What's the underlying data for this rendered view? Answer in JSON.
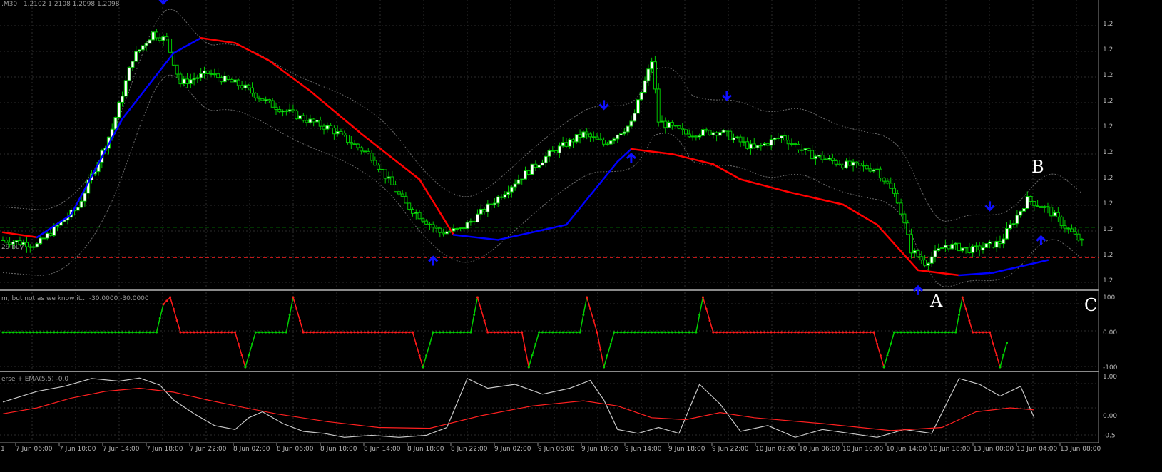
{
  "header": {
    "main_title": "",
    "main_prices": "1.2102 1.2108 1.2098 1.2098",
    "main_title_partial": ",M30",
    "osc1_title": "m, but not as we know it... -30.0000 -30.0000",
    "osc2_title": "erse + EMA(5,5) -0.0",
    "line_label": "29 buy"
  },
  "markers": {
    "a": "A",
    "b": "B",
    "c": "C"
  },
  "colors": {
    "bull_candle": "#00c800",
    "body_fill": "#ffffff",
    "ma_up": "#0000ff",
    "ma_down": "#ff0000",
    "osc_up": "#00d000",
    "osc_down": "#ff1a1a",
    "signal_arrow": "#1010ff",
    "osc2_line": "#c8c8c8",
    "osc2_ema": "#ff2020"
  },
  "x_ticks": [
    "7 Jun 06:00",
    "7 Jun 10:00",
    "7 Jun 14:00",
    "7 Jun 18:00",
    "7 Jun 22:00",
    "8 Jun 02:00",
    "8 Jun 06:00",
    "8 Jun 10:00",
    "8 Jun 14:00",
    "8 Jun 18:00",
    "8 Jun 22:00",
    "9 Jun 02:00",
    "9 Jun 06:00",
    "9 Jun 10:00",
    "9 Jun 14:00",
    "9 Jun 18:00",
    "9 Jun 22:00",
    "10 Jun 02:00",
    "10 Jun 06:00",
    "10 Jun 10:00",
    "10 Jun 14:00",
    "10 Jun 18:00",
    "13 Jun 00:00",
    "13 Jun 04:00",
    "13 Jun 08:00"
  ],
  "x_tick_start": "1",
  "chart_data": [
    {
      "type": "line",
      "title": "",
      "y_tick_labels": [
        "1.2",
        "1.2",
        "1.2",
        "1.2",
        "1.2",
        "1.2",
        "1.2",
        "1.2",
        "1.2",
        "1.2",
        "1.2"
      ],
      "price_path": [
        [
          0,
          0.14
        ],
        [
          10,
          0.12
        ],
        [
          22,
          0.27
        ],
        [
          32,
          0.58
        ],
        [
          38,
          0.86
        ],
        [
          44,
          0.96
        ],
        [
          48,
          0.93
        ],
        [
          52,
          0.76
        ],
        [
          60,
          0.8
        ],
        [
          70,
          0.75
        ],
        [
          78,
          0.68
        ],
        [
          88,
          0.62
        ],
        [
          96,
          0.58
        ],
        [
          108,
          0.47
        ],
        [
          118,
          0.28
        ],
        [
          128,
          0.17
        ],
        [
          134,
          0.18
        ],
        [
          142,
          0.27
        ],
        [
          150,
          0.37
        ],
        [
          160,
          0.48
        ],
        [
          170,
          0.56
        ],
        [
          176,
          0.52
        ],
        [
          184,
          0.6
        ],
        [
          190,
          0.85
        ],
        [
          192,
          0.61
        ],
        [
          200,
          0.56
        ],
        [
          210,
          0.57
        ],
        [
          220,
          0.5
        ],
        [
          228,
          0.55
        ],
        [
          236,
          0.48
        ],
        [
          246,
          0.44
        ],
        [
          256,
          0.42
        ],
        [
          262,
          0.3
        ],
        [
          266,
          0.1
        ],
        [
          270,
          0.05
        ],
        [
          276,
          0.12
        ],
        [
          284,
          0.1
        ],
        [
          292,
          0.13
        ],
        [
          300,
          0.3
        ],
        [
          306,
          0.26
        ],
        [
          312,
          0.18
        ],
        [
          316,
          0.13
        ]
      ],
      "ma_path": [
        [
          0,
          0.17,
          "d"
        ],
        [
          10,
          0.15,
          "d"
        ],
        [
          20,
          0.24,
          "u"
        ],
        [
          35,
          0.62,
          "u"
        ],
        [
          50,
          0.88,
          "u"
        ],
        [
          58,
          0.94,
          "u"
        ],
        [
          68,
          0.92,
          "d"
        ],
        [
          78,
          0.85,
          "d"
        ],
        [
          90,
          0.73,
          "d"
        ],
        [
          105,
          0.56,
          "d"
        ],
        [
          122,
          0.38,
          "d"
        ],
        [
          132,
          0.16,
          "d"
        ],
        [
          145,
          0.14,
          "u"
        ],
        [
          165,
          0.2,
          "u"
        ],
        [
          180,
          0.45,
          "u"
        ],
        [
          184,
          0.5,
          "u"
        ],
        [
          196,
          0.48,
          "d"
        ],
        [
          208,
          0.44,
          "d"
        ],
        [
          216,
          0.38,
          "d"
        ],
        [
          230,
          0.33,
          "d"
        ],
        [
          246,
          0.28,
          "d"
        ],
        [
          256,
          0.2,
          "d"
        ],
        [
          268,
          0.02,
          "d"
        ],
        [
          280,
          0.0,
          "d"
        ],
        [
          290,
          0.01,
          "u"
        ],
        [
          306,
          0.06,
          "u"
        ]
      ],
      "signals_down": [
        47,
        176,
        212,
        289
      ],
      "signals_up": [
        126,
        184,
        268,
        304
      ],
      "levels": [
        {
          "y": 0.19,
          "color": "#00c800"
        },
        {
          "y": 0.07,
          "color": "#ff2020"
        }
      ]
    },
    {
      "type": "line",
      "title": "",
      "y_tick_labels": [
        "100",
        "0.00",
        "-100"
      ],
      "ylim": [
        -100,
        100
      ],
      "segments": [
        {
          "x": [
            0,
            45
          ],
          "y": [
            0,
            0
          ],
          "c": "up"
        },
        {
          "x": [
            45,
            47
          ],
          "y": [
            0,
            80
          ],
          "c": "up"
        },
        {
          "x": [
            47,
            49
          ],
          "y": [
            80,
            100
          ],
          "c": "down"
        },
        {
          "x": [
            49,
            52
          ],
          "y": [
            100,
            0
          ],
          "c": "down"
        },
        {
          "x": [
            52,
            68
          ],
          "y": [
            0,
            0
          ],
          "c": "down"
        },
        {
          "x": [
            68,
            71
          ],
          "y": [
            0,
            -100
          ],
          "c": "down"
        },
        {
          "x": [
            71,
            74
          ],
          "y": [
            -100,
            0
          ],
          "c": "up"
        },
        {
          "x": [
            74,
            83
          ],
          "y": [
            0,
            0
          ],
          "c": "up"
        },
        {
          "x": [
            83,
            85
          ],
          "y": [
            0,
            100
          ],
          "c": "up"
        },
        {
          "x": [
            85,
            88
          ],
          "y": [
            100,
            0
          ],
          "c": "down"
        },
        {
          "x": [
            88,
            120
          ],
          "y": [
            0,
            0
          ],
          "c": "down"
        },
        {
          "x": [
            120,
            123
          ],
          "y": [
            0,
            -100
          ],
          "c": "down"
        },
        {
          "x": [
            123,
            126
          ],
          "y": [
            -100,
            0
          ],
          "c": "up"
        },
        {
          "x": [
            126,
            137
          ],
          "y": [
            0,
            0
          ],
          "c": "up"
        },
        {
          "x": [
            137,
            139
          ],
          "y": [
            0,
            100
          ],
          "c": "up"
        },
        {
          "x": [
            139,
            142
          ],
          "y": [
            100,
            0
          ],
          "c": "down"
        },
        {
          "x": [
            142,
            152
          ],
          "y": [
            0,
            0
          ],
          "c": "down"
        },
        {
          "x": [
            152,
            154
          ],
          "y": [
            0,
            -100
          ],
          "c": "down"
        },
        {
          "x": [
            154,
            157
          ],
          "y": [
            -100,
            0
          ],
          "c": "up"
        },
        {
          "x": [
            157,
            169
          ],
          "y": [
            0,
            0
          ],
          "c": "up"
        },
        {
          "x": [
            169,
            171
          ],
          "y": [
            0,
            100
          ],
          "c": "up"
        },
        {
          "x": [
            171,
            174
          ],
          "y": [
            100,
            0
          ],
          "c": "down"
        },
        {
          "x": [
            174,
            176
          ],
          "y": [
            0,
            -100
          ],
          "c": "down"
        },
        {
          "x": [
            176,
            179
          ],
          "y": [
            -100,
            0
          ],
          "c": "up"
        },
        {
          "x": [
            179,
            203
          ],
          "y": [
            0,
            0
          ],
          "c": "up"
        },
        {
          "x": [
            203,
            205
          ],
          "y": [
            0,
            100
          ],
          "c": "up"
        },
        {
          "x": [
            205,
            208
          ],
          "y": [
            100,
            0
          ],
          "c": "down"
        },
        {
          "x": [
            208,
            255
          ],
          "y": [
            0,
            0
          ],
          "c": "down"
        },
        {
          "x": [
            255,
            258
          ],
          "y": [
            0,
            -100
          ],
          "c": "down"
        },
        {
          "x": [
            258,
            261
          ],
          "y": [
            -100,
            0
          ],
          "c": "up"
        },
        {
          "x": [
            261,
            279
          ],
          "y": [
            0,
            0
          ],
          "c": "up"
        },
        {
          "x": [
            279,
            281
          ],
          "y": [
            0,
            100
          ],
          "c": "up"
        },
        {
          "x": [
            281,
            284
          ],
          "y": [
            100,
            0
          ],
          "c": "down"
        },
        {
          "x": [
            284,
            289
          ],
          "y": [
            0,
            0
          ],
          "c": "down"
        },
        {
          "x": [
            289,
            292
          ],
          "y": [
            0,
            -100
          ],
          "c": "down"
        },
        {
          "x": [
            292,
            294
          ],
          "y": [
            -100,
            -30
          ],
          "c": "up"
        }
      ]
    },
    {
      "type": "line",
      "title": "",
      "y_tick_labels": [
        "1.00",
        "0.00",
        "-0.5"
      ],
      "series": [
        {
          "name": "",
          "values": [
            [
              0,
              0.35
            ],
            [
              10,
              0.62
            ],
            [
              18,
              0.75
            ],
            [
              26,
              0.95
            ],
            [
              34,
              0.88
            ],
            [
              40,
              0.96
            ],
            [
              46,
              0.78
            ],
            [
              50,
              0.4
            ],
            [
              56,
              0.05
            ],
            [
              62,
              -0.25
            ],
            [
              68,
              -0.35
            ],
            [
              72,
              -0.05
            ],
            [
              76,
              0.1
            ],
            [
              82,
              -0.2
            ],
            [
              88,
              -0.4
            ],
            [
              94,
              -0.45
            ],
            [
              100,
              -0.55
            ],
            [
              108,
              -0.5
            ],
            [
              116,
              -0.55
            ],
            [
              124,
              -0.5
            ],
            [
              130,
              -0.3
            ],
            [
              136,
              0.95
            ],
            [
              142,
              0.7
            ],
            [
              150,
              0.8
            ],
            [
              158,
              0.55
            ],
            [
              166,
              0.7
            ],
            [
              172,
              0.9
            ],
            [
              176,
              0.4
            ],
            [
              180,
              -0.35
            ],
            [
              186,
              -0.45
            ],
            [
              192,
              -0.3
            ],
            [
              198,
              -0.45
            ],
            [
              204,
              0.8
            ],
            [
              210,
              0.3
            ],
            [
              216,
              -0.4
            ],
            [
              224,
              -0.25
            ],
            [
              232,
              -0.55
            ],
            [
              240,
              -0.35
            ],
            [
              248,
              -0.45
            ],
            [
              256,
              -0.55
            ],
            [
              264,
              -0.35
            ],
            [
              272,
              -0.45
            ],
            [
              280,
              0.95
            ],
            [
              286,
              0.8
            ],
            [
              292,
              0.5
            ],
            [
              298,
              0.75
            ],
            [
              302,
              -0.05
            ]
          ]
        },
        {
          "name": "",
          "values": [
            [
              0,
              0.05
            ],
            [
              10,
              0.2
            ],
            [
              20,
              0.45
            ],
            [
              30,
              0.62
            ],
            [
              40,
              0.7
            ],
            [
              50,
              0.6
            ],
            [
              60,
              0.4
            ],
            [
              70,
              0.22
            ],
            [
              80,
              0.05
            ],
            [
              95,
              -0.15
            ],
            [
              110,
              -0.3
            ],
            [
              125,
              -0.32
            ],
            [
              140,
              0.0
            ],
            [
              155,
              0.25
            ],
            [
              170,
              0.38
            ],
            [
              180,
              0.25
            ],
            [
              190,
              -0.05
            ],
            [
              200,
              -0.1
            ],
            [
              210,
              0.08
            ],
            [
              220,
              -0.05
            ],
            [
              240,
              -0.2
            ],
            [
              260,
              -0.38
            ],
            [
              275,
              -0.3
            ],
            [
              285,
              0.1
            ],
            [
              295,
              0.2
            ],
            [
              302,
              0.15
            ]
          ]
        }
      ]
    }
  ]
}
